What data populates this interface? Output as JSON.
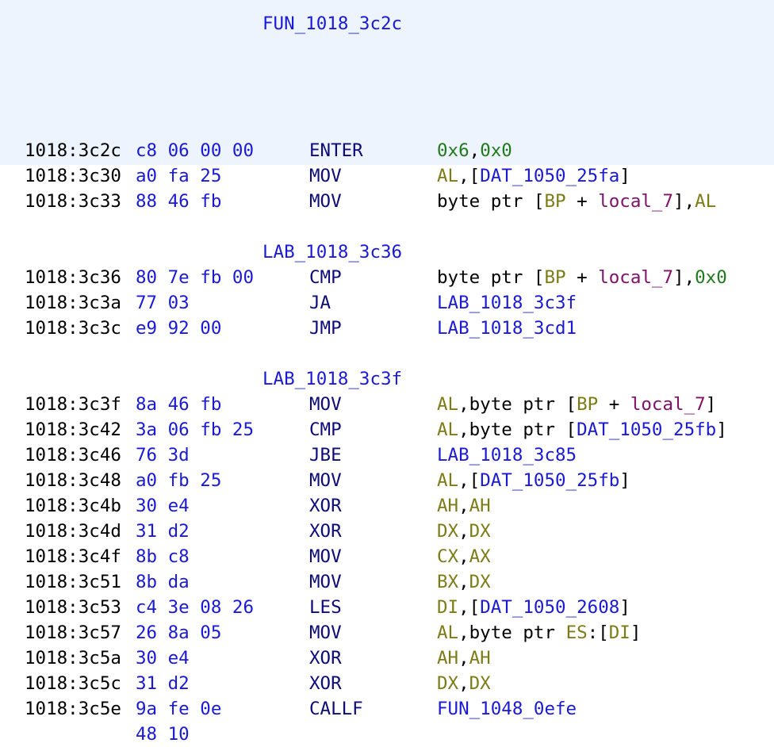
{
  "function_header": {
    "label": "FUN_1018_3c2c"
  },
  "rows": [
    {
      "kind": "label",
      "label": "FUN_1018_3c2c"
    },
    {
      "kind": "blank"
    },
    {
      "kind": "blank"
    },
    {
      "kind": "blank"
    },
    {
      "kind": "blank"
    },
    {
      "kind": "instr",
      "addr": "1018:3c2c",
      "bytes": "c8 06 00 00",
      "mnemonic": "ENTER",
      "operands": [
        {
          "t": "0x6",
          "c": "sc"
        },
        {
          "t": ",",
          "c": ""
        },
        {
          "t": "0x0",
          "c": "sc"
        }
      ]
    },
    {
      "kind": "instr",
      "addr": "1018:3c30",
      "bytes": "a0 fa 25",
      "mnemonic": "MOV",
      "operands": [
        {
          "t": "AL",
          "c": "reg"
        },
        {
          "t": ",[",
          "c": ""
        },
        {
          "t": "DAT_1050_25fa",
          "c": "ref"
        },
        {
          "t": "]",
          "c": ""
        }
      ]
    },
    {
      "kind": "instr",
      "addr": "1018:3c33",
      "bytes": "88 46 fb",
      "mnemonic": "MOV",
      "operands": [
        {
          "t": "byte ptr [",
          "c": ""
        },
        {
          "t": "BP",
          "c": "reg"
        },
        {
          "t": " + ",
          "c": ""
        },
        {
          "t": "local_7",
          "c": "lcl"
        },
        {
          "t": "],",
          "c": ""
        },
        {
          "t": "AL",
          "c": "reg"
        }
      ]
    },
    {
      "kind": "blank"
    },
    {
      "kind": "label",
      "label": "LAB_1018_3c36"
    },
    {
      "kind": "instr",
      "addr": "1018:3c36",
      "bytes": "80 7e fb 00",
      "mnemonic": "CMP",
      "operands": [
        {
          "t": "byte ptr [",
          "c": ""
        },
        {
          "t": "BP",
          "c": "reg"
        },
        {
          "t": " + ",
          "c": ""
        },
        {
          "t": "local_7",
          "c": "lcl"
        },
        {
          "t": "],",
          "c": ""
        },
        {
          "t": "0x0",
          "c": "sc"
        }
      ]
    },
    {
      "kind": "instr",
      "addr": "1018:3c3a",
      "bytes": "77 03",
      "mnemonic": "JA",
      "operands": [
        {
          "t": "LAB_1018_3c3f",
          "c": "ref"
        }
      ]
    },
    {
      "kind": "instr",
      "addr": "1018:3c3c",
      "bytes": "e9 92 00",
      "mnemonic": "JMP",
      "operands": [
        {
          "t": "LAB_1018_3cd1",
          "c": "ref"
        }
      ]
    },
    {
      "kind": "blank"
    },
    {
      "kind": "label",
      "label": "LAB_1018_3c3f"
    },
    {
      "kind": "instr",
      "addr": "1018:3c3f",
      "bytes": "8a 46 fb",
      "mnemonic": "MOV",
      "operands": [
        {
          "t": "AL",
          "c": "reg"
        },
        {
          "t": ",byte ptr [",
          "c": ""
        },
        {
          "t": "BP",
          "c": "reg"
        },
        {
          "t": " + ",
          "c": ""
        },
        {
          "t": "local_7",
          "c": "lcl"
        },
        {
          "t": "]",
          "c": ""
        }
      ]
    },
    {
      "kind": "instr",
      "addr": "1018:3c42",
      "bytes": "3a 06 fb 25",
      "mnemonic": "CMP",
      "operands": [
        {
          "t": "AL",
          "c": "reg"
        },
        {
          "t": ",byte ptr [",
          "c": ""
        },
        {
          "t": "DAT_1050_25fb",
          "c": "ref"
        },
        {
          "t": "]",
          "c": ""
        }
      ]
    },
    {
      "kind": "instr",
      "addr": "1018:3c46",
      "bytes": "76 3d",
      "mnemonic": "JBE",
      "operands": [
        {
          "t": "LAB_1018_3c85",
          "c": "ref"
        }
      ]
    },
    {
      "kind": "instr",
      "addr": "1018:3c48",
      "bytes": "a0 fb 25",
      "mnemonic": "MOV",
      "operands": [
        {
          "t": "AL",
          "c": "reg"
        },
        {
          "t": ",[",
          "c": ""
        },
        {
          "t": "DAT_1050_25fb",
          "c": "ref"
        },
        {
          "t": "]",
          "c": ""
        }
      ]
    },
    {
      "kind": "instr",
      "addr": "1018:3c4b",
      "bytes": "30 e4",
      "mnemonic": "XOR",
      "operands": [
        {
          "t": "AH",
          "c": "reg"
        },
        {
          "t": ",",
          "c": ""
        },
        {
          "t": "AH",
          "c": "reg"
        }
      ]
    },
    {
      "kind": "instr",
      "addr": "1018:3c4d",
      "bytes": "31 d2",
      "mnemonic": "XOR",
      "operands": [
        {
          "t": "DX",
          "c": "reg"
        },
        {
          "t": ",",
          "c": ""
        },
        {
          "t": "DX",
          "c": "reg"
        }
      ]
    },
    {
      "kind": "instr",
      "addr": "1018:3c4f",
      "bytes": "8b c8",
      "mnemonic": "MOV",
      "operands": [
        {
          "t": "CX",
          "c": "reg"
        },
        {
          "t": ",",
          "c": ""
        },
        {
          "t": "AX",
          "c": "reg"
        }
      ]
    },
    {
      "kind": "instr",
      "addr": "1018:3c51",
      "bytes": "8b da",
      "mnemonic": "MOV",
      "operands": [
        {
          "t": "BX",
          "c": "reg"
        },
        {
          "t": ",",
          "c": ""
        },
        {
          "t": "DX",
          "c": "reg"
        }
      ]
    },
    {
      "kind": "instr",
      "addr": "1018:3c53",
      "bytes": "c4 3e 08 26",
      "mnemonic": "LES",
      "operands": [
        {
          "t": "DI",
          "c": "reg"
        },
        {
          "t": ",[",
          "c": ""
        },
        {
          "t": "DAT_1050_2608",
          "c": "ref"
        },
        {
          "t": "]",
          "c": ""
        }
      ]
    },
    {
      "kind": "instr",
      "addr": "1018:3c57",
      "bytes": "26 8a 05",
      "mnemonic": "MOV",
      "operands": [
        {
          "t": "AL",
          "c": "reg"
        },
        {
          "t": ",byte ptr ",
          "c": ""
        },
        {
          "t": "ES",
          "c": "reg"
        },
        {
          "t": ":[",
          "c": ""
        },
        {
          "t": "DI",
          "c": "reg"
        },
        {
          "t": "]",
          "c": ""
        }
      ]
    },
    {
      "kind": "instr",
      "addr": "1018:3c5a",
      "bytes": "30 e4",
      "mnemonic": "XOR",
      "operands": [
        {
          "t": "AH",
          "c": "reg"
        },
        {
          "t": ",",
          "c": ""
        },
        {
          "t": "AH",
          "c": "reg"
        }
      ]
    },
    {
      "kind": "instr",
      "addr": "1018:3c5c",
      "bytes": "31 d2",
      "mnemonic": "XOR",
      "operands": [
        {
          "t": "DX",
          "c": "reg"
        },
        {
          "t": ",",
          "c": ""
        },
        {
          "t": "DX",
          "c": "reg"
        }
      ]
    },
    {
      "kind": "instr",
      "addr": "1018:3c5e",
      "bytes": "9a fe 0e",
      "mnemonic": "CALLF",
      "operands": [
        {
          "t": "FUN_1048_0efe",
          "c": "ref"
        }
      ]
    },
    {
      "kind": "cont",
      "bytes": "48 10"
    }
  ]
}
